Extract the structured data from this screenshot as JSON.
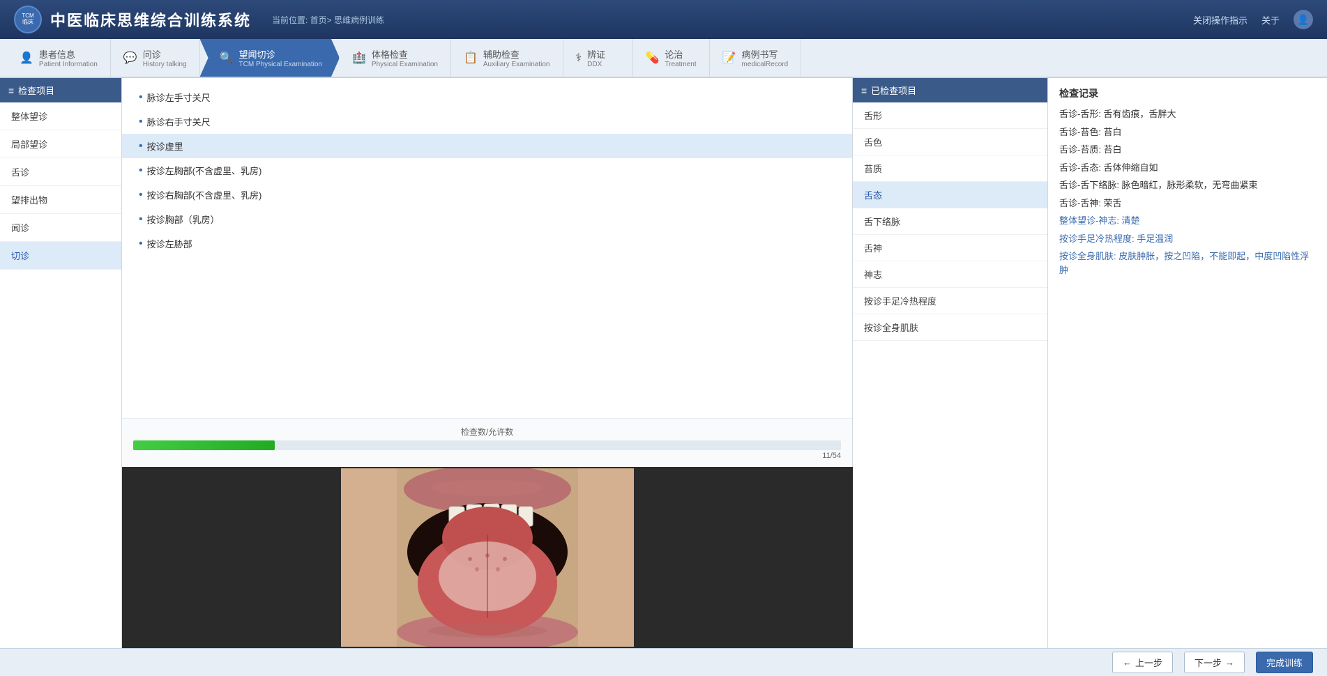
{
  "app": {
    "title": "中医临床思维综合训练系统",
    "breadcrumb": "当前位置: 首页> 思维病例训练",
    "close_guide": "关闭操作指示",
    "about": "关于"
  },
  "nav": {
    "tabs": [
      {
        "id": "patient",
        "zh": "患者信息",
        "en": "Patient Information",
        "icon": "👤",
        "active": false
      },
      {
        "id": "inquiry",
        "zh": "问诊",
        "en": "History talking",
        "icon": "💬",
        "active": false
      },
      {
        "id": "tcm_exam",
        "zh": "望闻切诊",
        "en": "TCM Physical Examination",
        "icon": "🔍",
        "active": true
      },
      {
        "id": "phys_exam",
        "zh": "体格检查",
        "en": "Physical Examination",
        "icon": "🏥",
        "active": false
      },
      {
        "id": "aux_exam",
        "zh": "辅助检查",
        "en": "Auxiliary Examination",
        "icon": "📋",
        "active": false
      },
      {
        "id": "ddx",
        "zh": "辨证",
        "en": "DDX",
        "icon": "⚕",
        "active": false
      },
      {
        "id": "treatment",
        "zh": "论治",
        "en": "Treatment",
        "icon": "💊",
        "active": false
      },
      {
        "id": "record",
        "zh": "病例书写",
        "en": "medicalRecord",
        "icon": "📝",
        "active": false
      }
    ]
  },
  "sidebar": {
    "header": "检查项目",
    "items": [
      {
        "id": "general_inspection",
        "label": "整体望诊",
        "active": false
      },
      {
        "id": "local_inspection",
        "label": "局部望诊",
        "active": false
      },
      {
        "id": "tongue_inspection",
        "label": "舌诊",
        "active": false
      },
      {
        "id": "inspect_excretion",
        "label": "望排出物",
        "active": false
      },
      {
        "id": "hearing_smell",
        "label": "闻诊",
        "active": false
      },
      {
        "id": "palpation",
        "label": "切诊",
        "active": true
      }
    ]
  },
  "middle_panel": {
    "items": [
      {
        "id": "pulse_left",
        "label": "脉诊左手寸关尺",
        "selected": false
      },
      {
        "id": "pulse_right",
        "label": "脉诊右手寸关尺",
        "selected": false
      },
      {
        "id": "press_deficiency",
        "label": "按诊虚里",
        "selected": true
      },
      {
        "id": "press_left_chest",
        "label": "按诊左胸部(不含虚里、乳房)",
        "selected": false
      },
      {
        "id": "press_right_chest",
        "label": "按诊右胸部(不含虚里、乳房)",
        "selected": false
      },
      {
        "id": "press_breast",
        "label": "按诊胸部（乳房）",
        "selected": false
      },
      {
        "id": "press_left_flank",
        "label": "按诊左胁部",
        "selected": false
      }
    ],
    "progress_label": "检查数/允许数",
    "progress_value": 11,
    "progress_max": 54,
    "progress_text": "11/54"
  },
  "right_panel": {
    "header": "已检查项目",
    "items": [
      {
        "id": "tongue_shape",
        "label": "舌形",
        "active": false
      },
      {
        "id": "tongue_color",
        "label": "舌色",
        "active": false
      },
      {
        "id": "tongue_coating_quality",
        "label": "苔质",
        "active": false
      },
      {
        "id": "tongue_state",
        "label": "舌态",
        "active": true
      },
      {
        "id": "sublingual_vein",
        "label": "舌下络脉",
        "active": false
      },
      {
        "id": "tongue_spirit",
        "label": "舌神",
        "active": false
      },
      {
        "id": "spirit",
        "label": "神志",
        "active": false
      },
      {
        "id": "foot_temp",
        "label": "按诊手足冷热程度",
        "active": false
      },
      {
        "id": "press_edema",
        "label": "按诊全身肌肤",
        "active": false
      }
    ]
  },
  "records": {
    "title": "检查记录",
    "items": [
      {
        "id": "r1",
        "text": "舌诊-舌形: 舌有齿痕，舌胖大",
        "blue": false
      },
      {
        "id": "r2",
        "text": "舌诊-苔色: 苔白",
        "blue": false
      },
      {
        "id": "r3",
        "text": "舌诊-苔质: 苔白",
        "blue": false
      },
      {
        "id": "r4",
        "text": "舌诊-舌态: 舌体伸缩自如",
        "blue": false
      },
      {
        "id": "r5",
        "text": "舌诊-舌下络脉: 脉色暗红，脉形柔软，无弯曲紧束",
        "blue": false
      },
      {
        "id": "r6",
        "text": "舌诊-舌神: 荣舌",
        "blue": false
      },
      {
        "id": "r7",
        "text": "整体望诊-神志: 清楚",
        "blue": true
      },
      {
        "id": "r8",
        "text": "按诊手足冷热程度: 手足温润",
        "blue": true
      },
      {
        "id": "r9",
        "text": "按诊全身肌肤: 皮肤肿胀，按之凹陷，不能即起，中度凹陷性浮肿",
        "blue": true
      }
    ]
  },
  "footer": {
    "prev_label": "上一步",
    "next_label": "下一步",
    "finish_label": "完成训练"
  }
}
